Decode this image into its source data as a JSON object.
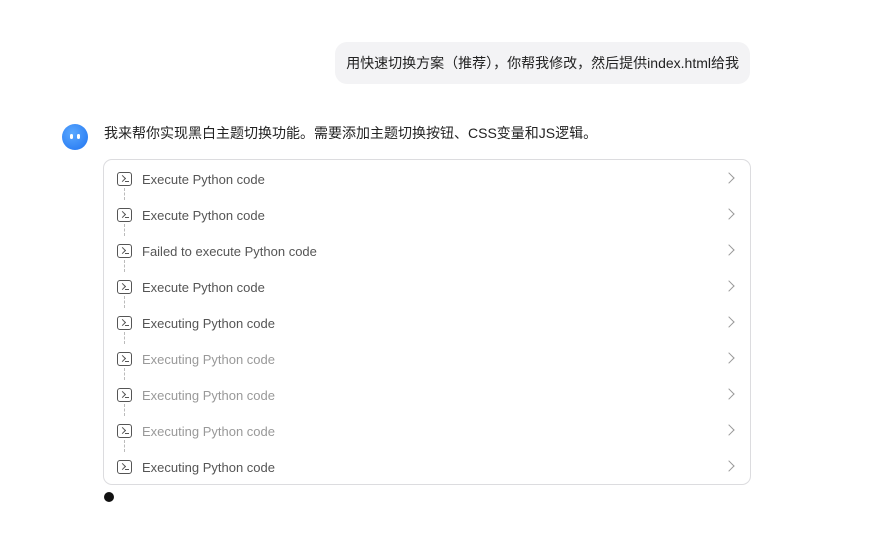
{
  "user_message": "用快速切换方案（推荐），你帮我修改，然后提供index.html给我",
  "assistant": {
    "reply": "我来帮你实现黑白主题切换功能。需要添加主题切换按钮、CSS变量和JS逻辑。",
    "steps": [
      {
        "label": "Execute Python code",
        "icon": "terminal-icon"
      },
      {
        "label": "Execute Python code",
        "icon": "terminal-icon"
      },
      {
        "label": "Failed to execute Python code",
        "icon": "terminal-icon"
      },
      {
        "label": "Execute Python code",
        "icon": "terminal-icon"
      },
      {
        "label": "Executing Python code",
        "icon": "terminal-icon"
      },
      {
        "label": "Executing Python code",
        "icon": "terminal-icon"
      },
      {
        "label": "Executing Python code",
        "icon": "terminal-icon"
      },
      {
        "label": "Executing Python code",
        "icon": "terminal-icon"
      },
      {
        "label": "Executing Python code",
        "icon": "terminal-icon"
      }
    ]
  },
  "colors": {
    "avatar": "#1f73f0",
    "bubble": "#f3f3f5"
  }
}
